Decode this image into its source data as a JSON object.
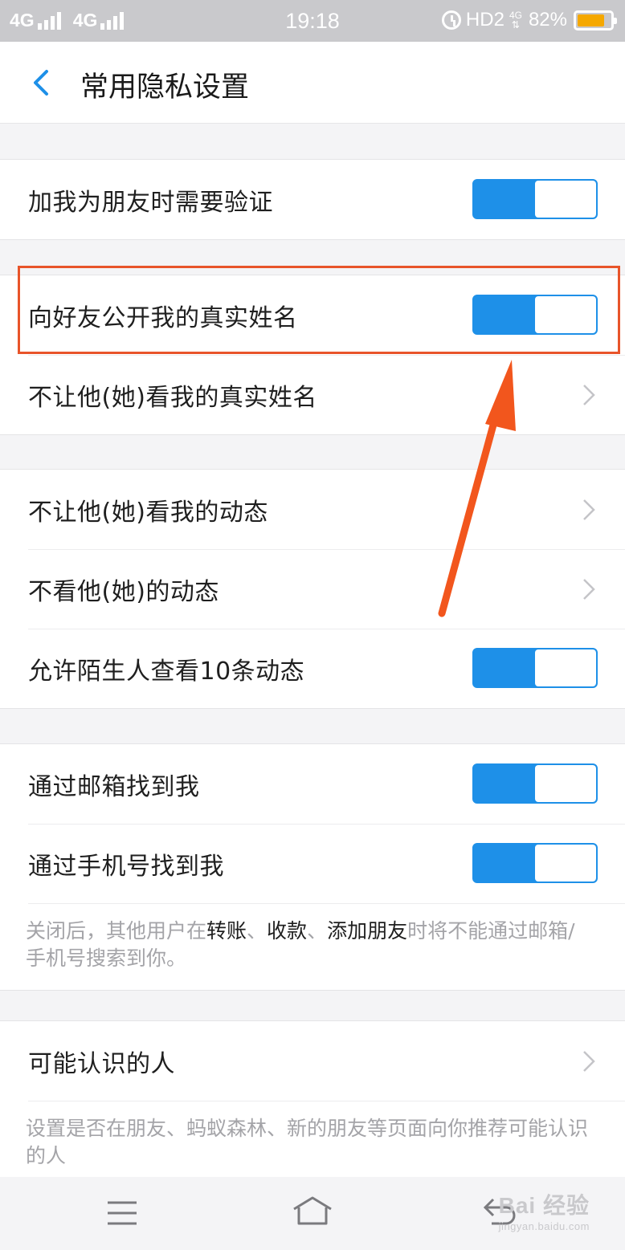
{
  "status_bar": {
    "net1": "4G",
    "net2": "4G",
    "time": "19:18",
    "hd": "HD2",
    "mini_net": "4G",
    "battery_text": "82%",
    "battery_level": 0.82,
    "battery_color": "#f5a800"
  },
  "header": {
    "title": "常用隐私设置"
  },
  "groups": {
    "g1": {
      "verify_label": "加我为朋友时需要验证"
    },
    "g2": {
      "show_name_label": "向好友公开我的真实姓名",
      "hide_name_label": "不让他(她)看我的真实姓名"
    },
    "g3": {
      "hide_moments_label": "不让他(她)看我的动态",
      "not_view_label": "不看他(她)的动态",
      "stranger_label": "允许陌生人查看10条动态"
    },
    "g4": {
      "email_label": "通过邮箱找到我",
      "phone_label": "通过手机号找到我",
      "note_prefix": "关闭后，其他用户在",
      "note_em1": "转账",
      "note_sep1": "、",
      "note_em2": "收款",
      "note_sep2": "、",
      "note_em3": "添加朋友",
      "note_suffix": "时将不能通过邮箱/手机号搜索到你。"
    },
    "g5": {
      "people_label": "可能认识的人",
      "people_note": "设置是否在朋友、蚂蚁森林、新的朋友等页面向你推荐可能认识的人"
    }
  },
  "toggles": {
    "on_color": "#1e90e8",
    "verify": true,
    "show_name": true,
    "stranger": true,
    "email": true,
    "phone": true
  },
  "annotation": {
    "color": "#e8542a"
  },
  "watermark": {
    "top": "Bai 经验",
    "bottom": "jingyan.baidu.com"
  }
}
